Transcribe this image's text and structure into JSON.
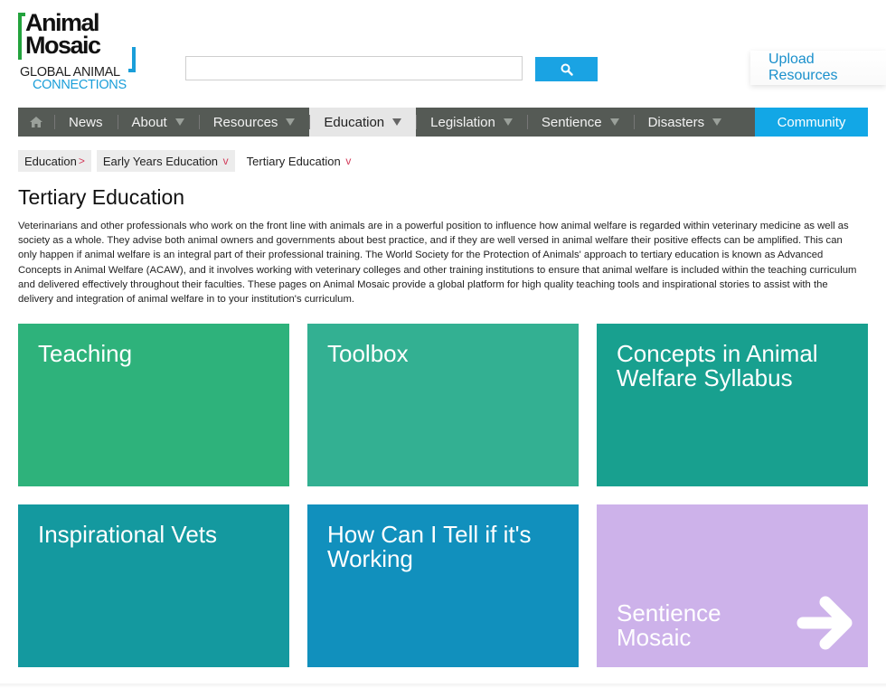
{
  "logo": {
    "line1": "Animal",
    "line2": "Mosaic",
    "sub1": "GLOBAL ANIMAL",
    "sub2": "CONNECTIONS"
  },
  "search": {
    "value": "",
    "placeholder": "",
    "button_icon": "search-icon"
  },
  "header": {
    "upload_label": "Upload Resources"
  },
  "nav": {
    "home_icon": "home-icon",
    "items": [
      {
        "label": "News"
      },
      {
        "label": "About"
      },
      {
        "label": "Resources"
      },
      {
        "label": "Education"
      },
      {
        "label": "Legislation"
      },
      {
        "label": "Sentience"
      },
      {
        "label": "Disasters"
      }
    ],
    "community_label": "Community"
  },
  "breadcrumbs": [
    {
      "label": "Education",
      "sep": ">"
    },
    {
      "label": "Early Years Education",
      "sep": "v"
    },
    {
      "label": "Tertiary Education",
      "sep": "v"
    }
  ],
  "page": {
    "title": "Tertiary Education",
    "intro": "Veterinarians and other professionals who work on the front line with animals are in a powerful position to influence how animal welfare is regarded within veterinary medicine as well as society as a whole. They advise both animal owners and governments about best practice, and if they are well versed in animal welfare their positive effects can be amplified. This can only happen if animal welfare is an integral part of their professional training. The World Society for the Protection of Animals' approach to tertiary education is known as Advanced Concepts in Animal Welfare (ACAW), and it involves working with veterinary colleges and other training institutions to ensure that animal welfare is included within the teaching curriculum and delivered effectively throughout their faculties. These pages on Animal Mosaic provide a global platform for high quality teaching tools and inspirational stories to assist with the delivery and integration of animal welfare in to your institution's curriculum."
  },
  "tiles": [
    {
      "title": "Teaching",
      "color": "#2eb27b"
    },
    {
      "title": "Toolbox",
      "color": "#33b092"
    },
    {
      "title": "Concepts in Animal Welfare Syllabus",
      "color": "#18a08f"
    },
    {
      "title": "Inspirational Vets",
      "color": "#14999f"
    },
    {
      "title": "How Can I Tell if it's Working",
      "color": "#1190bd"
    },
    {
      "title": "Sentience Mosaic",
      "color": "#cdb2ea",
      "icon": "arrow-right-icon"
    }
  ],
  "colors": {
    "accent_blue": "#1aa3e3",
    "nav_bg": "#555a55",
    "breadcrumb_sep": "#d23b5a"
  }
}
